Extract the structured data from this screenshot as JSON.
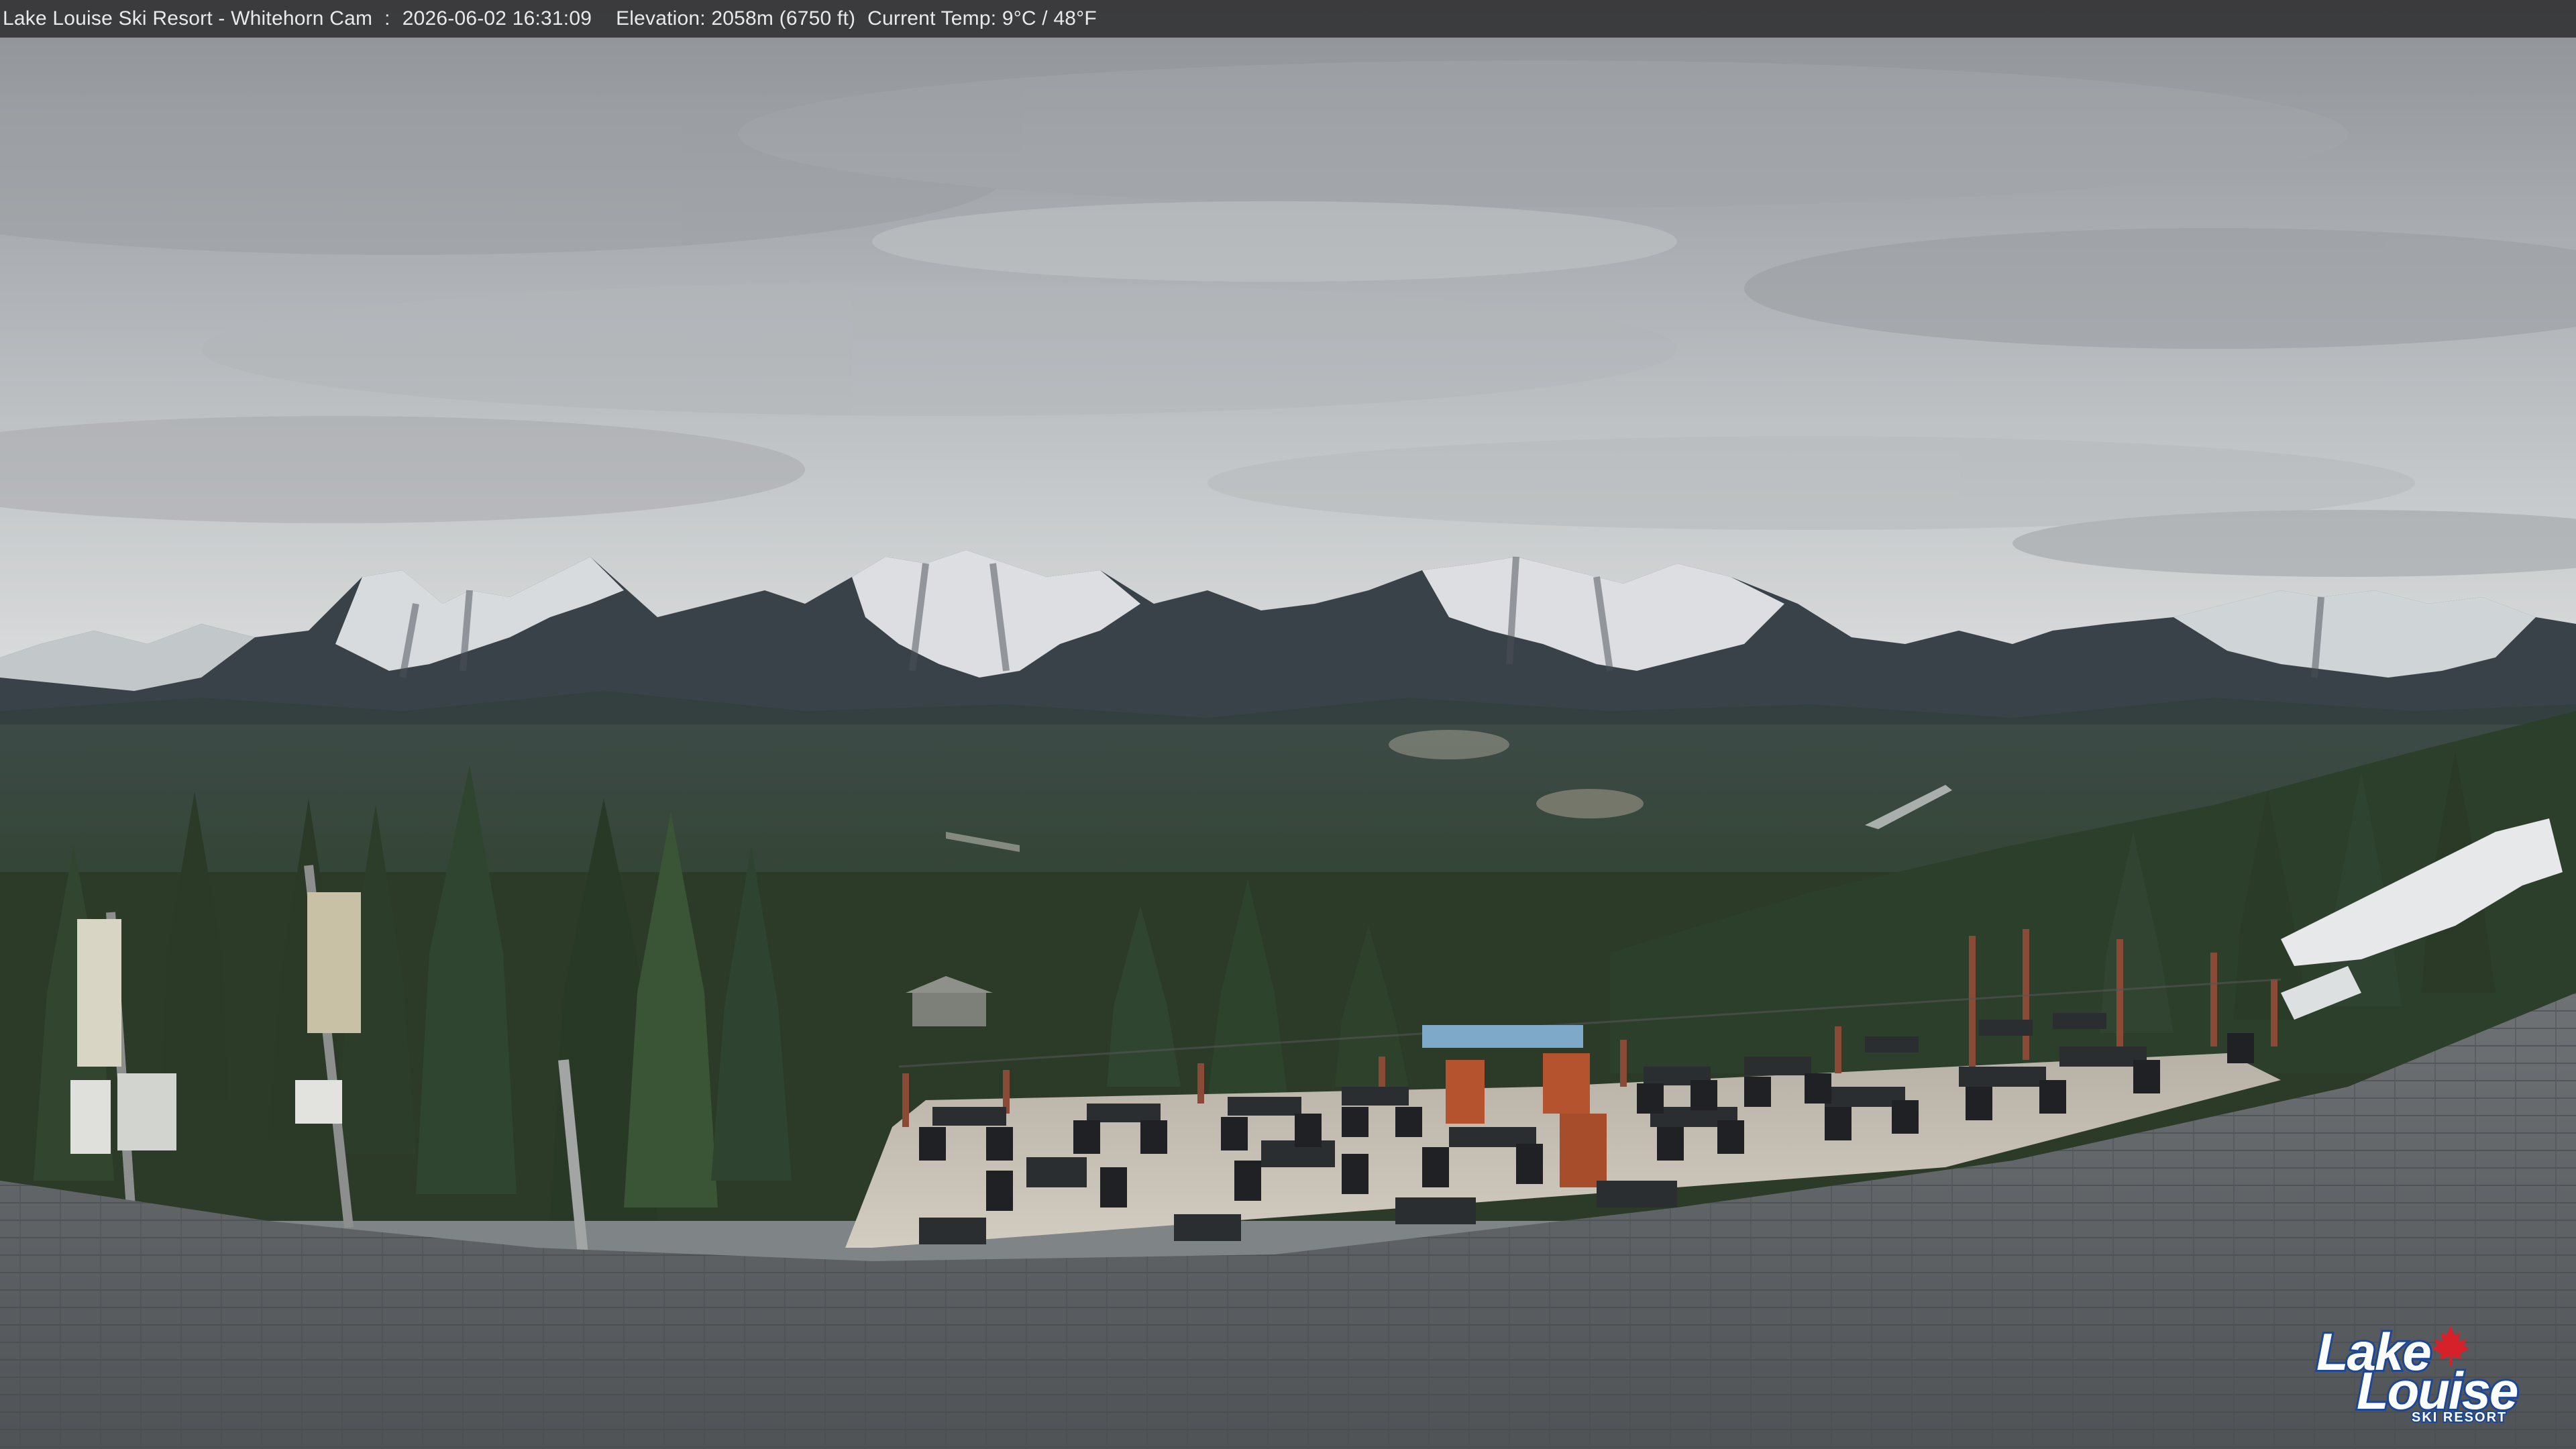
{
  "overlay": {
    "location": "Lake Louise Ski Resort - Whitehorn Cam",
    "separator": ":",
    "datetime": "2026-06-02 16:31:09",
    "elevation": "Elevation: 2058m (6750 ft)",
    "temperature": "Current Temp: 9°C / 48°F"
  },
  "logo": {
    "line1": "Lake",
    "line2": "Louise",
    "line3": "SKI RESORT",
    "accent_color": "#d6202a",
    "brand_color": "#1b4796"
  },
  "scene": {
    "sky_color": "#b9bcbf",
    "mountain_snow_color": "#eef0f2",
    "forest_color": "#2e3d2a",
    "roof_color": "#5f6366",
    "deck_color": "#c9c2b6"
  }
}
